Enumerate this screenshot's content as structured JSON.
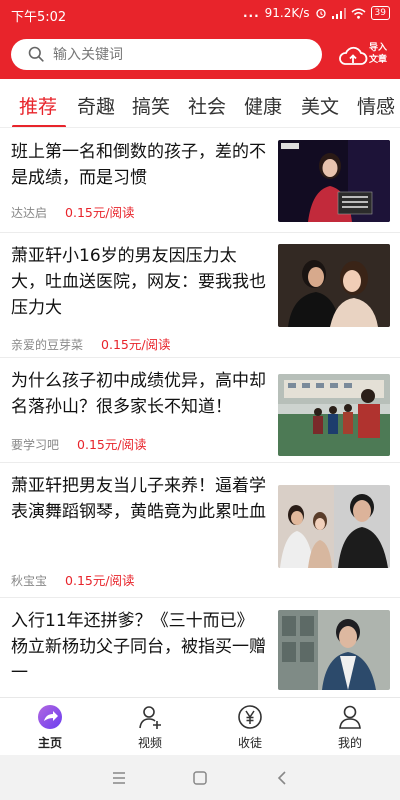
{
  "status_bar": {
    "time": "下午5:02",
    "signal_dots": "...",
    "speed": "91.2K/s",
    "battery": "39",
    "icons": [
      "alarm-icon",
      "signal-icon",
      "wifi-icon",
      "battery-icon"
    ]
  },
  "search": {
    "placeholder": "输入关键词",
    "icon": "search-icon"
  },
  "import_button": {
    "icon": "cloud-upload-icon",
    "line1": "导入",
    "line2": "文章"
  },
  "tabs": [
    {
      "label": "推荐",
      "active": true
    },
    {
      "label": "奇趣",
      "active": false
    },
    {
      "label": "搞笑",
      "active": false
    },
    {
      "label": "社会",
      "active": false
    },
    {
      "label": "健康",
      "active": false
    },
    {
      "label": "美文",
      "active": false
    },
    {
      "label": "情感",
      "active": false
    }
  ],
  "feed": [
    {
      "title": "班上第一名和倒数的孩子，差的不是成绩，而是习惯",
      "author": "达达启",
      "price": "0.15元/阅读"
    },
    {
      "title": "萧亚轩小16岁的男友因压力太大，吐血送医院，网友：要我我也压力大",
      "author": "亲爱的豆芽菜",
      "price": "0.15元/阅读"
    },
    {
      "title": "为什么孩子初中成绩优异，高中却名落孙山？很多家长不知道！",
      "author": "要学习吧",
      "price": "0.15元/阅读"
    },
    {
      "title": "萧亚轩把男友当儿子来养！逼着学表演舞蹈钢琴，黄皓竟为此累吐血",
      "author": "秋宝宝",
      "price": "0.15元/阅读"
    },
    {
      "title": "入行11年还拼爹？《三十而已》杨立新杨玏父子同台，被指买一赠一",
      "author": "",
      "price": ""
    }
  ],
  "bottom_nav": [
    {
      "label": "主页",
      "icon": "home-icon",
      "active": true
    },
    {
      "label": "视频",
      "icon": "video-user-icon",
      "active": false
    },
    {
      "label": "收徒",
      "icon": "yuan-coin-icon",
      "active": false
    },
    {
      "label": "我的",
      "icon": "profile-icon",
      "active": false
    }
  ],
  "system_nav": [
    "menu-icon",
    "home-square-icon",
    "back-icon"
  ],
  "colors": {
    "brand": "#e8242b",
    "price": "#e8242b"
  }
}
